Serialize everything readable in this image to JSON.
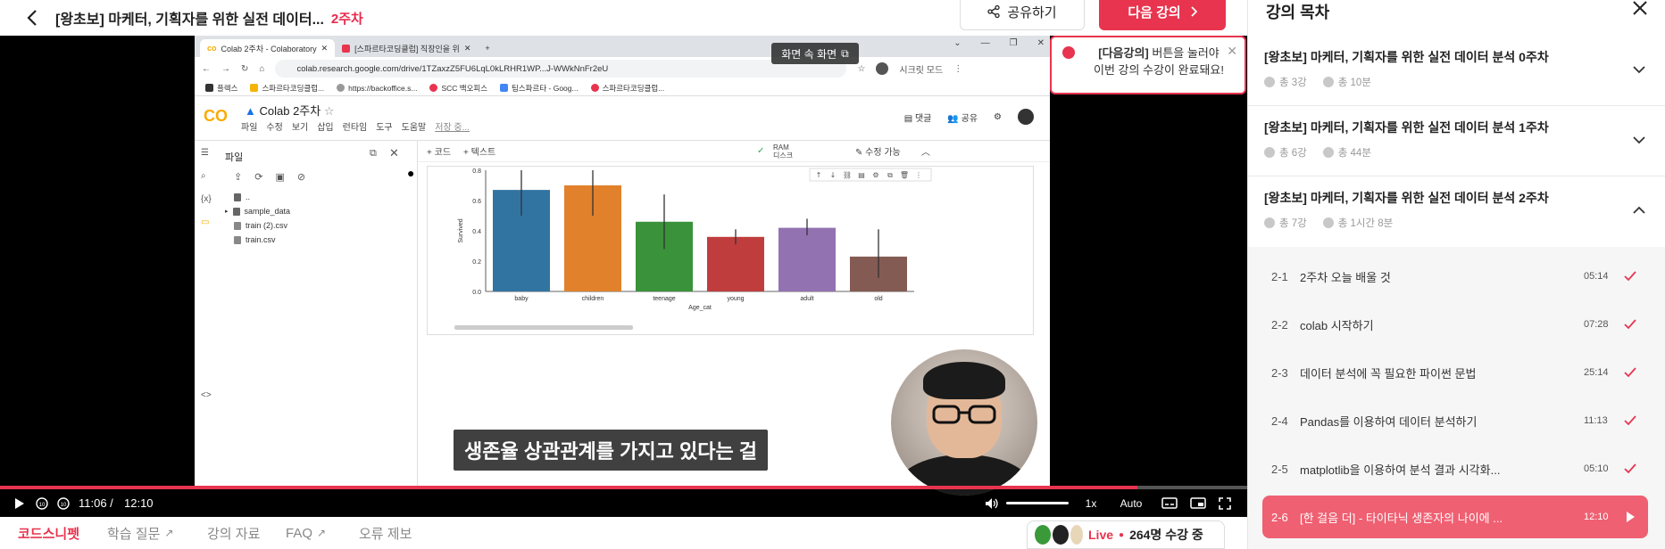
{
  "header": {
    "course_title": "[왕초보] 마케터, 기획자를 위한 실전 데이터...",
    "week": "2주차",
    "share_label": "공유하기",
    "next_label": "다음 강의"
  },
  "notification": {
    "bold": "[다음강의]",
    "line1": " 버튼을 눌러야",
    "line2": "이번 강의 수강이 완료돼요!"
  },
  "video": {
    "subtitle": "생존율 상관관계를 가지고 있다는 걸",
    "current_time": "11:06 /",
    "total_time": "12:10",
    "progress": 0.912,
    "speed": "1x",
    "quality": "Auto",
    "pip_label": "화면 속 화면"
  },
  "screen": {
    "tabs": [
      "Colab 2주차 - Colaboratory",
      "[스파르타코딩클럽] 직장인을 위"
    ],
    "url": "colab.research.google.com/drive/1TZaxzZ5FU6LqL0kLRHR1WP...J-WWkNnFr2eU",
    "profile": "시크릿 모드",
    "bookmarks": [
      "플렉스",
      "스파르타코딩클럽...",
      "https://backoffice.s...",
      "SCC 백오피스",
      "팀스파르타 - Goog...",
      "스파르타코딩클럽..."
    ],
    "notebook_name": "Colab 2주차",
    "menu": [
      "파일",
      "수정",
      "보기",
      "삽입",
      "런타임",
      "도구",
      "도움말",
      "저장 중..."
    ],
    "right_actions": [
      "댓글",
      "공유"
    ],
    "files_title": "파일",
    "files": [
      "..",
      "sample_data",
      "train (2).csv",
      "train.csv"
    ],
    "toolbar": [
      "+ 코드",
      "+ 텍스트"
    ],
    "ram_label": "RAM",
    "disk_label": "디스크",
    "edit_label": "수정 가능"
  },
  "chart_data": {
    "type": "bar",
    "categories": [
      "baby",
      "children",
      "teenage",
      "young",
      "adult",
      "old"
    ],
    "values": [
      0.67,
      0.7,
      0.46,
      0.36,
      0.42,
      0.23
    ],
    "errors": [
      [
        0.5,
        0.82
      ],
      [
        0.5,
        0.85
      ],
      [
        0.28,
        0.64
      ],
      [
        0.31,
        0.41
      ],
      [
        0.37,
        0.48
      ],
      [
        0.09,
        0.41
      ]
    ],
    "colors": [
      "#3274a1",
      "#e1812c",
      "#3a923a",
      "#c03d3e",
      "#9372b2",
      "#845b53"
    ],
    "xlabel": "Age_cat",
    "ylabel": "Survived",
    "yticks": [
      "0.0",
      "0.2",
      "0.4",
      "0.6",
      "0.8"
    ],
    "ylim": [
      0,
      0.8
    ]
  },
  "tabs": [
    {
      "label": "코드스니펫",
      "active": true
    },
    {
      "label": "학습 질문",
      "ext": true
    },
    {
      "label": "강의 자료"
    },
    {
      "label": "FAQ",
      "ext": true
    },
    {
      "label": "오류 제보"
    }
  ],
  "live": {
    "label": "Live",
    "count": "264명 수강 중"
  },
  "sidebar": {
    "title": "강의 목차",
    "weeks": [
      {
        "title": "[왕초보] 마케터, 기획자를 위한 실전 데이터 분석 0주차",
        "count": "총 3강",
        "duration": "총 10분"
      },
      {
        "title": "[왕초보] 마케터, 기획자를 위한 실전 데이터 분석 1주차",
        "count": "총 6강",
        "duration": "총 44분"
      },
      {
        "title": "[왕초보] 마케터, 기획자를 위한 실전 데이터 분석 2주차",
        "count": "총 7강",
        "duration": "총 1시간 8분"
      }
    ],
    "lessons": [
      {
        "num": "2-1",
        "name": "2주차 오늘 배울 것",
        "duration": "05:14",
        "done": true
      },
      {
        "num": "2-2",
        "name": "colab 시작하기",
        "duration": "07:28",
        "done": true
      },
      {
        "num": "2-3",
        "name": "데이터 분석에 꼭 필요한 파이썬 문법",
        "duration": "25:14",
        "done": true
      },
      {
        "num": "2-4",
        "name": "Pandas를 이용하여 데이터 분석하기",
        "duration": "11:13",
        "done": true
      },
      {
        "num": "2-5",
        "name": "matplotlib을 이용하여 분석 결과 시각화...",
        "duration": "05:10",
        "done": true
      },
      {
        "num": "2-6",
        "name": "[한 걸음 더] - 타이타닉 생존자의 나이에 ...",
        "duration": "12:10",
        "current": true
      }
    ]
  }
}
